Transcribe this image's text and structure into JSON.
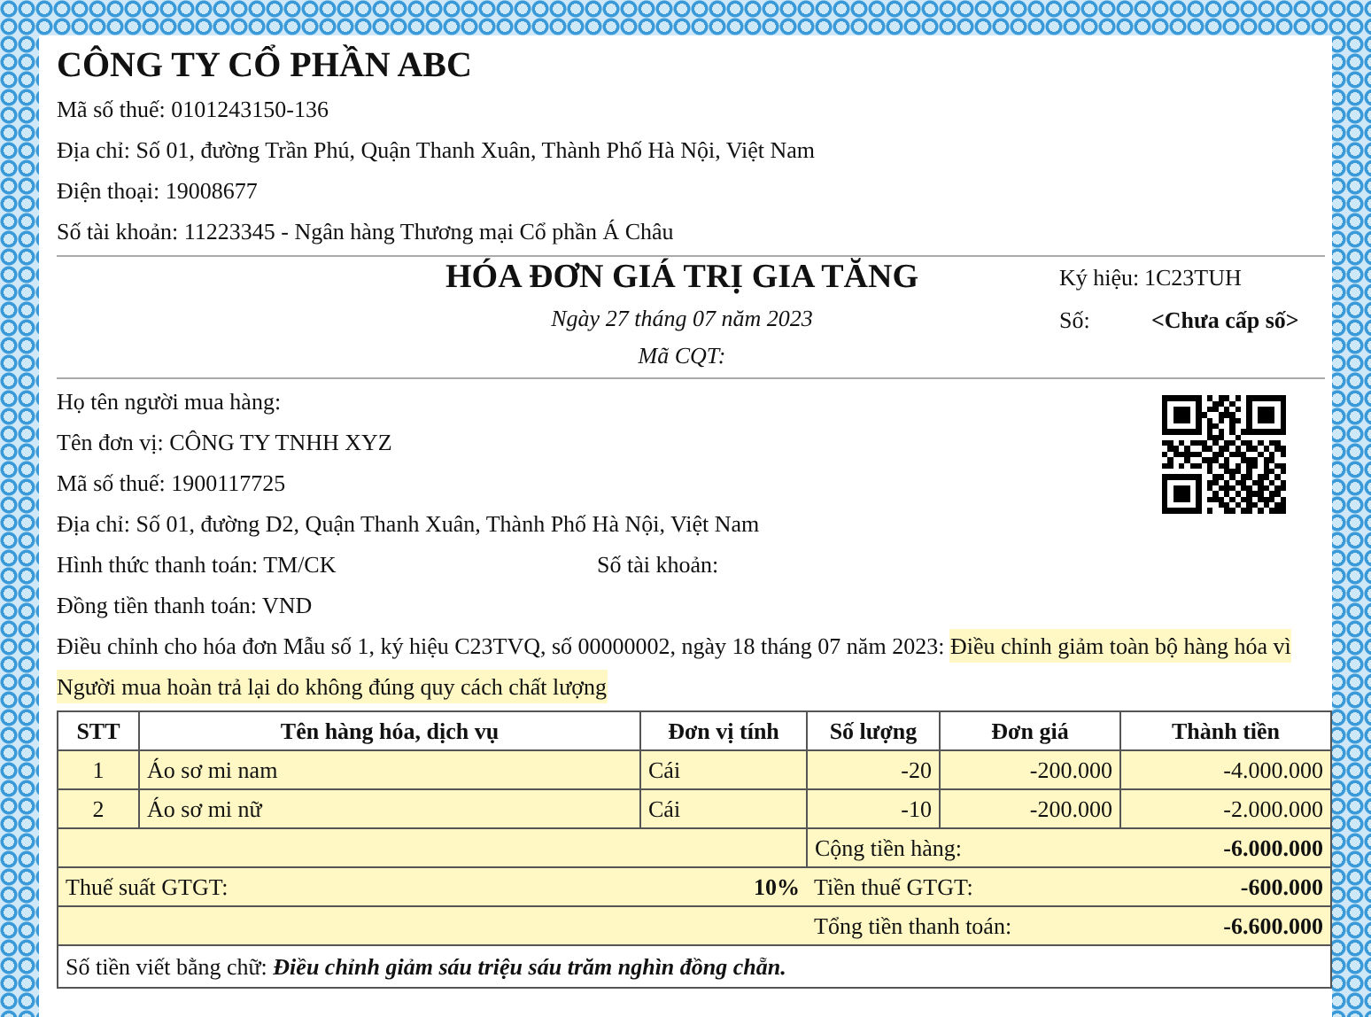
{
  "seller": {
    "name": "CÔNG TY CỔ PHẦN ABC",
    "lines": [
      {
        "label": "Mã số thuế:",
        "value": "0101243150-136"
      },
      {
        "label": "Địa chỉ:",
        "value": "Số 01, đường Trần Phú, Quận Thanh Xuân, Thành Phố Hà Nội, Việt Nam"
      },
      {
        "label": "Điện thoại:",
        "value": "19008677"
      },
      {
        "label": "Số tài khoản:",
        "value": "11223345 - Ngân hàng Thương mại Cổ phần Á Châu"
      }
    ]
  },
  "invoice": {
    "title": "HÓA ĐƠN GIÁ TRỊ GIA TĂNG",
    "date": "Ngày 27 tháng 07 năm 2023",
    "cqt": "Mã CQT:",
    "symbol_label": "Ký hiệu:",
    "symbol": "1C23TUH",
    "number_label": "Số:",
    "number": "<Chưa cấp số>"
  },
  "buyer": {
    "lines": [
      {
        "label": "Họ tên người mua hàng:"
      },
      {
        "label": "Tên đơn vị:",
        "value": "CÔNG TY TNHH XYZ"
      },
      {
        "label": "Mã số thuế:",
        "value": "1900117725"
      },
      {
        "label": "Địa chỉ:",
        "value": "Số 01, đường D2, Quận Thanh Xuân, Thành Phố Hà Nội, Việt Nam"
      }
    ],
    "payment_method": "Hình thức thanh toán: TM/CK",
    "account": "Số tài khoản:",
    "currency": "Đồng tiền thanh toán: VND"
  },
  "adjustment": {
    "reference": "Điều chỉnh cho hóa đơn Mẫu số 1, ký hiệu C23TVQ, số 00000002, ngày 18 tháng 07 năm 2023:",
    "reason_lines": [
      "Điều chỉnh giảm toàn bộ hàng hóa vì",
      "Người mua hoàn trả lại do không đúng quy cách chất lượng"
    ]
  },
  "table": {
    "columns": [
      "STT",
      "Tên hàng hóa, dịch vụ",
      "Đơn vị tính",
      "Số lượng",
      "Đơn giá",
      "Thành tiền"
    ],
    "rows": [
      [
        "1",
        "Áo sơ mi nam",
        "Cái",
        "-20",
        "-200.000",
        "-4.000.000"
      ],
      [
        "2",
        "Áo sơ mi nữ",
        "Cái",
        "-10",
        "-200.000",
        "-2.000.000"
      ]
    ]
  },
  "totals": {
    "subtotal_label": "Cộng tiền hàng:",
    "subtotal": "-6.000.000",
    "vat_rate_label": "Thuế suất GTGT:",
    "vat_rate": "10%",
    "vat_label": "Tiền thuế GTGT:",
    "vat": "-600.000",
    "total_label": "Tổng tiền thanh toán:",
    "total": "-6.600.000",
    "words_label": "Số tiền viết bằng chữ:",
    "words": "Điều chỉnh giảm sáu triệu sáu trăm nghìn đồng chẵn."
  }
}
